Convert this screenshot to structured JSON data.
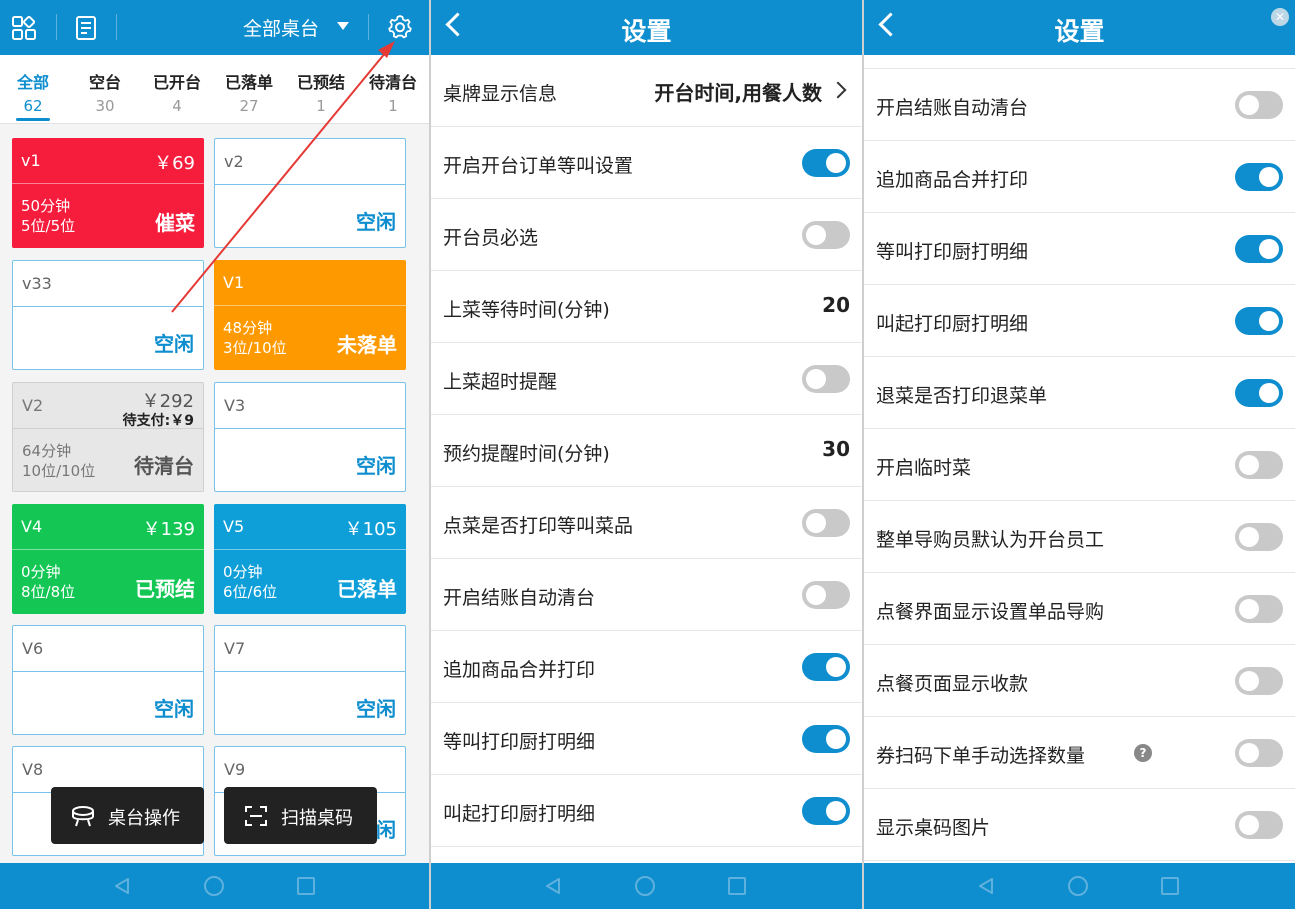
{
  "tables": {
    "dropdown_label": "全部桌台",
    "tabs": [
      {
        "label": "全部",
        "count": "62"
      },
      {
        "label": "空台",
        "count": "30"
      },
      {
        "label": "已开台",
        "count": "4"
      },
      {
        "label": "已落单",
        "count": "27"
      },
      {
        "label": "已预结",
        "count": "1"
      },
      {
        "label": "待清台",
        "count": "1"
      }
    ],
    "cards": [
      {
        "name": "v1",
        "price": "￥69",
        "time": "50分钟",
        "seats": "5位/5位",
        "status": "催菜"
      },
      {
        "name": "v2",
        "status": "空闲"
      },
      {
        "name": "v33",
        "status": "空闲"
      },
      {
        "name": "V1",
        "time": "48分钟",
        "seats": "3位/10位",
        "status": "未落单"
      },
      {
        "name": "V2",
        "price": "￥292",
        "due": "待支付:￥9",
        "time": "64分钟",
        "seats": "10位/10位",
        "status": "待清台"
      },
      {
        "name": "V3",
        "status": "空闲"
      },
      {
        "name": "V4",
        "price": "￥139",
        "time": "0分钟",
        "seats": "8位/8位",
        "status": "已预结"
      },
      {
        "name": "V5",
        "price": "￥105",
        "time": "0分钟",
        "seats": "6位/6位",
        "status": "已落单"
      },
      {
        "name": "V6",
        "status": "空闲"
      },
      {
        "name": "V7",
        "status": "空闲"
      },
      {
        "name": "V8",
        "status": "空闲"
      },
      {
        "name": "V9",
        "status": "空闲"
      }
    ],
    "btn_table_ops": "桌台操作",
    "btn_scan": "扫描桌码"
  },
  "settings": {
    "title": "设置",
    "rows": [
      {
        "label": "桌牌显示信息",
        "value": "开台时间,用餐人数"
      },
      {
        "label": "开启开台订单等叫设置",
        "on": true
      },
      {
        "label": "开台员必选",
        "on": false
      },
      {
        "label": "上菜等待时间(分钟)",
        "value": "20"
      },
      {
        "label": "上菜超时提醒",
        "on": false
      },
      {
        "label": "预约提醒时间(分钟)",
        "value": "30"
      },
      {
        "label": "点菜是否打印等叫菜品",
        "on": false
      },
      {
        "label": "开启结账自动清台",
        "on": false
      },
      {
        "label": "追加商品合并打印",
        "on": true
      },
      {
        "label": "等叫打印厨打明细",
        "on": true
      },
      {
        "label": "叫起打印厨打明细",
        "on": true
      }
    ]
  },
  "settings2": {
    "title": "设置",
    "rows": [
      {
        "label": "开启结账自动清台",
        "on": false
      },
      {
        "label": "追加商品合并打印",
        "on": true
      },
      {
        "label": "等叫打印厨打明细",
        "on": true
      },
      {
        "label": "叫起打印厨打明细",
        "on": true
      },
      {
        "label": "退菜是否打印退菜单",
        "on": true
      },
      {
        "label": "开启临时菜",
        "on": false
      },
      {
        "label": "整单导购员默认为开台员工",
        "on": false
      },
      {
        "label": "点餐界面显示设置单品导购",
        "on": false
      },
      {
        "label": "点餐页面显示收款",
        "on": false
      },
      {
        "label": "券扫码下单手动选择数量",
        "on": false,
        "help": true
      },
      {
        "label": "显示桌码图片",
        "on": false
      }
    ]
  },
  "colors": {
    "brand": "#0e8ece",
    "urge": "#f51c3c",
    "unordered": "#fe9a00",
    "prebilled": "#14c755",
    "ordered": "#0e9fd9",
    "annotation": "#e53935"
  }
}
